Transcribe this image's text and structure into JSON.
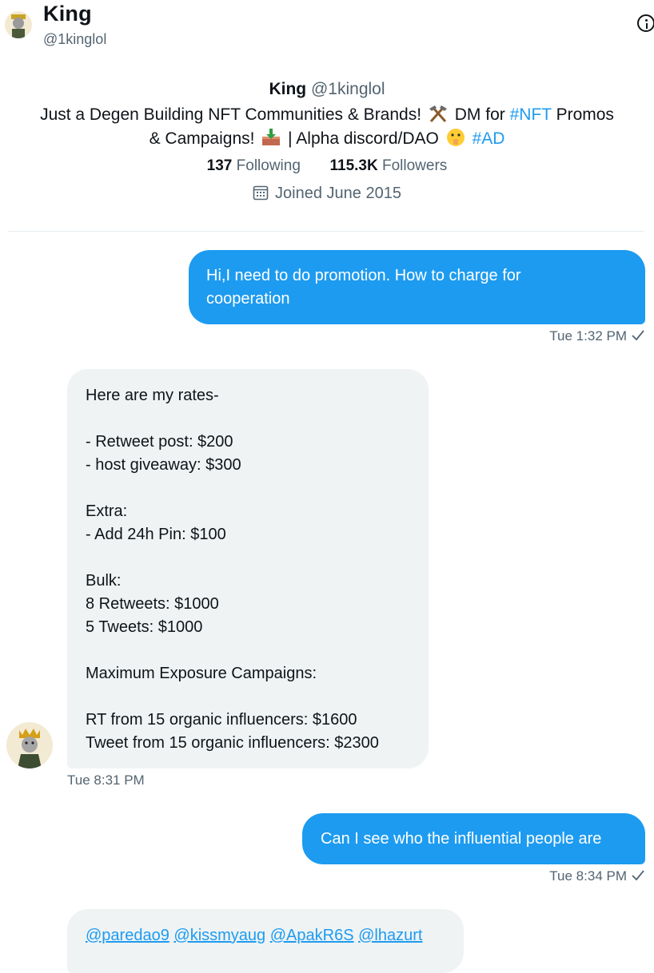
{
  "header": {
    "title": "King",
    "handle": "@1kinglol"
  },
  "profile": {
    "name": "King",
    "handle": "@1kinglol",
    "bio_part1": "Just a Degen Building NFT Communities & Brands!",
    "bio_part2": "DM for",
    "bio_tag1": "#NFT",
    "bio_part3": "Promos",
    "bio_part4": "& Campaigns!",
    "bio_part5": "| Alpha discord/DAO",
    "bio_tag2": "#AD",
    "following_count": "137",
    "following_label": "Following",
    "followers_count": "115.3K",
    "followers_label": "Followers",
    "joined": "Joined June 2015"
  },
  "messages": [
    {
      "direction": "outgoing",
      "lines": [
        "Hi,I need to do promotion. How to charge for",
        "cooperation"
      ],
      "time": "Tue 1:32 PM"
    },
    {
      "direction": "incoming",
      "lines": [
        "Here are my rates-",
        "",
        "- Retweet post: $200",
        "- host giveaway: $300",
        "",
        "Extra:",
        "- Add 24h Pin: $100",
        "",
        "Bulk:",
        "8 Retweets: $1000",
        "5 Tweets: $1000",
        "",
        "Maximum Exposure Campaigns:",
        "",
        "RT from 15 organic influencers: $1600",
        "Tweet from 15 organic influencers: $2300"
      ],
      "time": "Tue 8:31 PM"
    },
    {
      "direction": "outgoing",
      "lines": [
        "Can I see who the influential people are"
      ],
      "time": "Tue 8:34 PM"
    },
    {
      "direction": "incoming",
      "mentions": [
        "@paredao9",
        "@kissmyaug",
        "@ApakR6S",
        "@lhazurt"
      ]
    }
  ],
  "colors": {
    "accent": "#1d9bf0",
    "incoming_bubble": "#eff3f4",
    "muted_text": "#536471"
  },
  "icons": {
    "header_info": "info-icon",
    "joined": "calendar-icon",
    "read_receipt": "check-icon"
  }
}
